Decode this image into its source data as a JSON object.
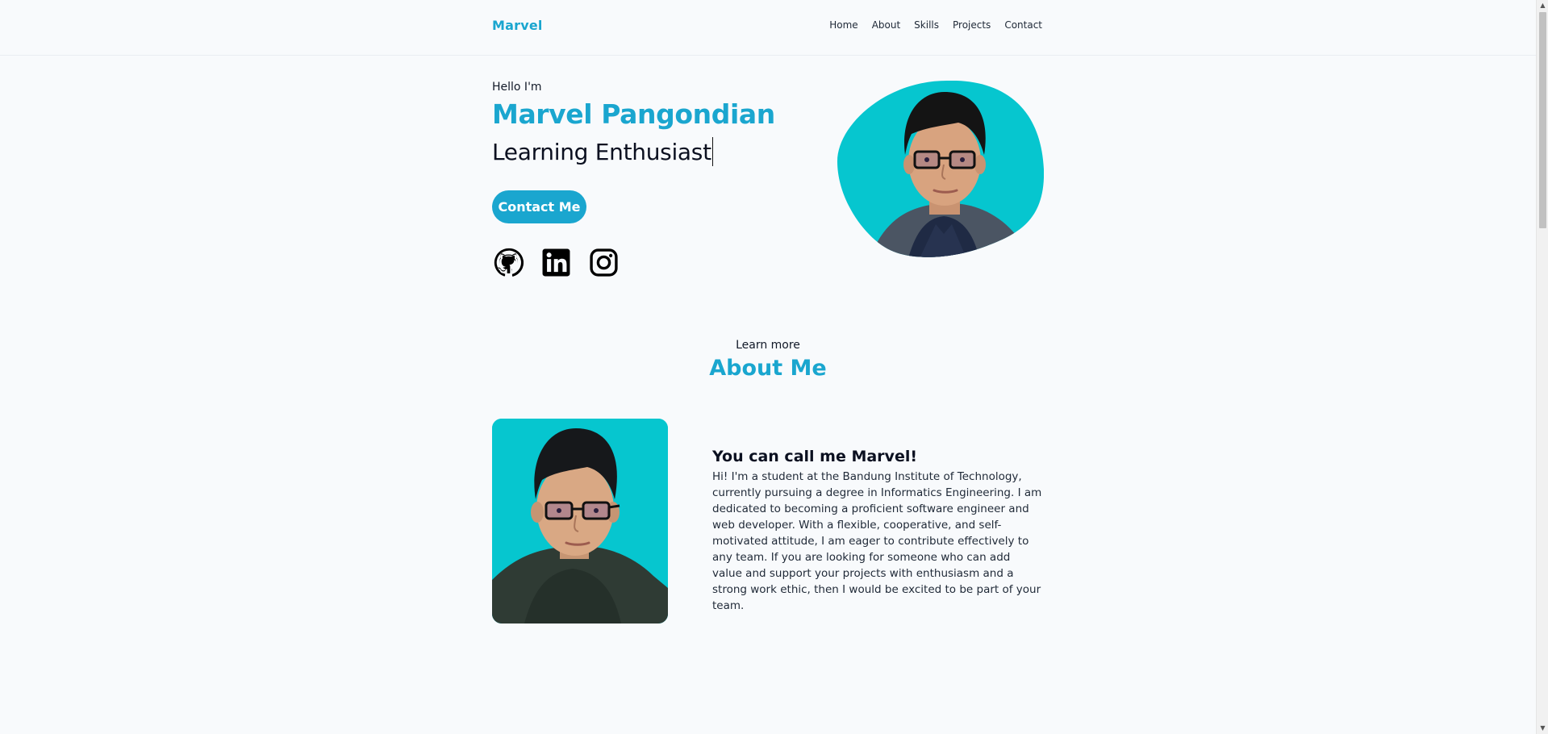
{
  "header": {
    "brand": "Marvel",
    "nav": [
      "Home",
      "About",
      "Skills",
      "Projects",
      "Contact"
    ]
  },
  "hero": {
    "greeting": "Hello I'm",
    "name": "Marvel Pangondian",
    "role": "Learning Enthusiast",
    "contact_button": "Contact Me",
    "socials": [
      "github-icon",
      "linkedin-icon",
      "instagram-icon"
    ]
  },
  "about": {
    "kicker": "Learn more",
    "title": "About Me",
    "heading": "You can call me Marvel!",
    "body": "Hi! I'm a student at the Bandung Institute of Technology, currently pursuing a degree in Informatics Engineering. I am dedicated to becoming a proficient software engineer and web developer. With a flexible, cooperative, and self-motivated attitude, I am eager to contribute effectively to any team. If you are looking for someone who can add value and support your projects with enthusiasm and a strong work ethic, then I would be excited to be part of your team."
  },
  "colors": {
    "accent": "#1aa6cf",
    "photo_bg": "#06c6cf",
    "background": "#f8fafc"
  }
}
